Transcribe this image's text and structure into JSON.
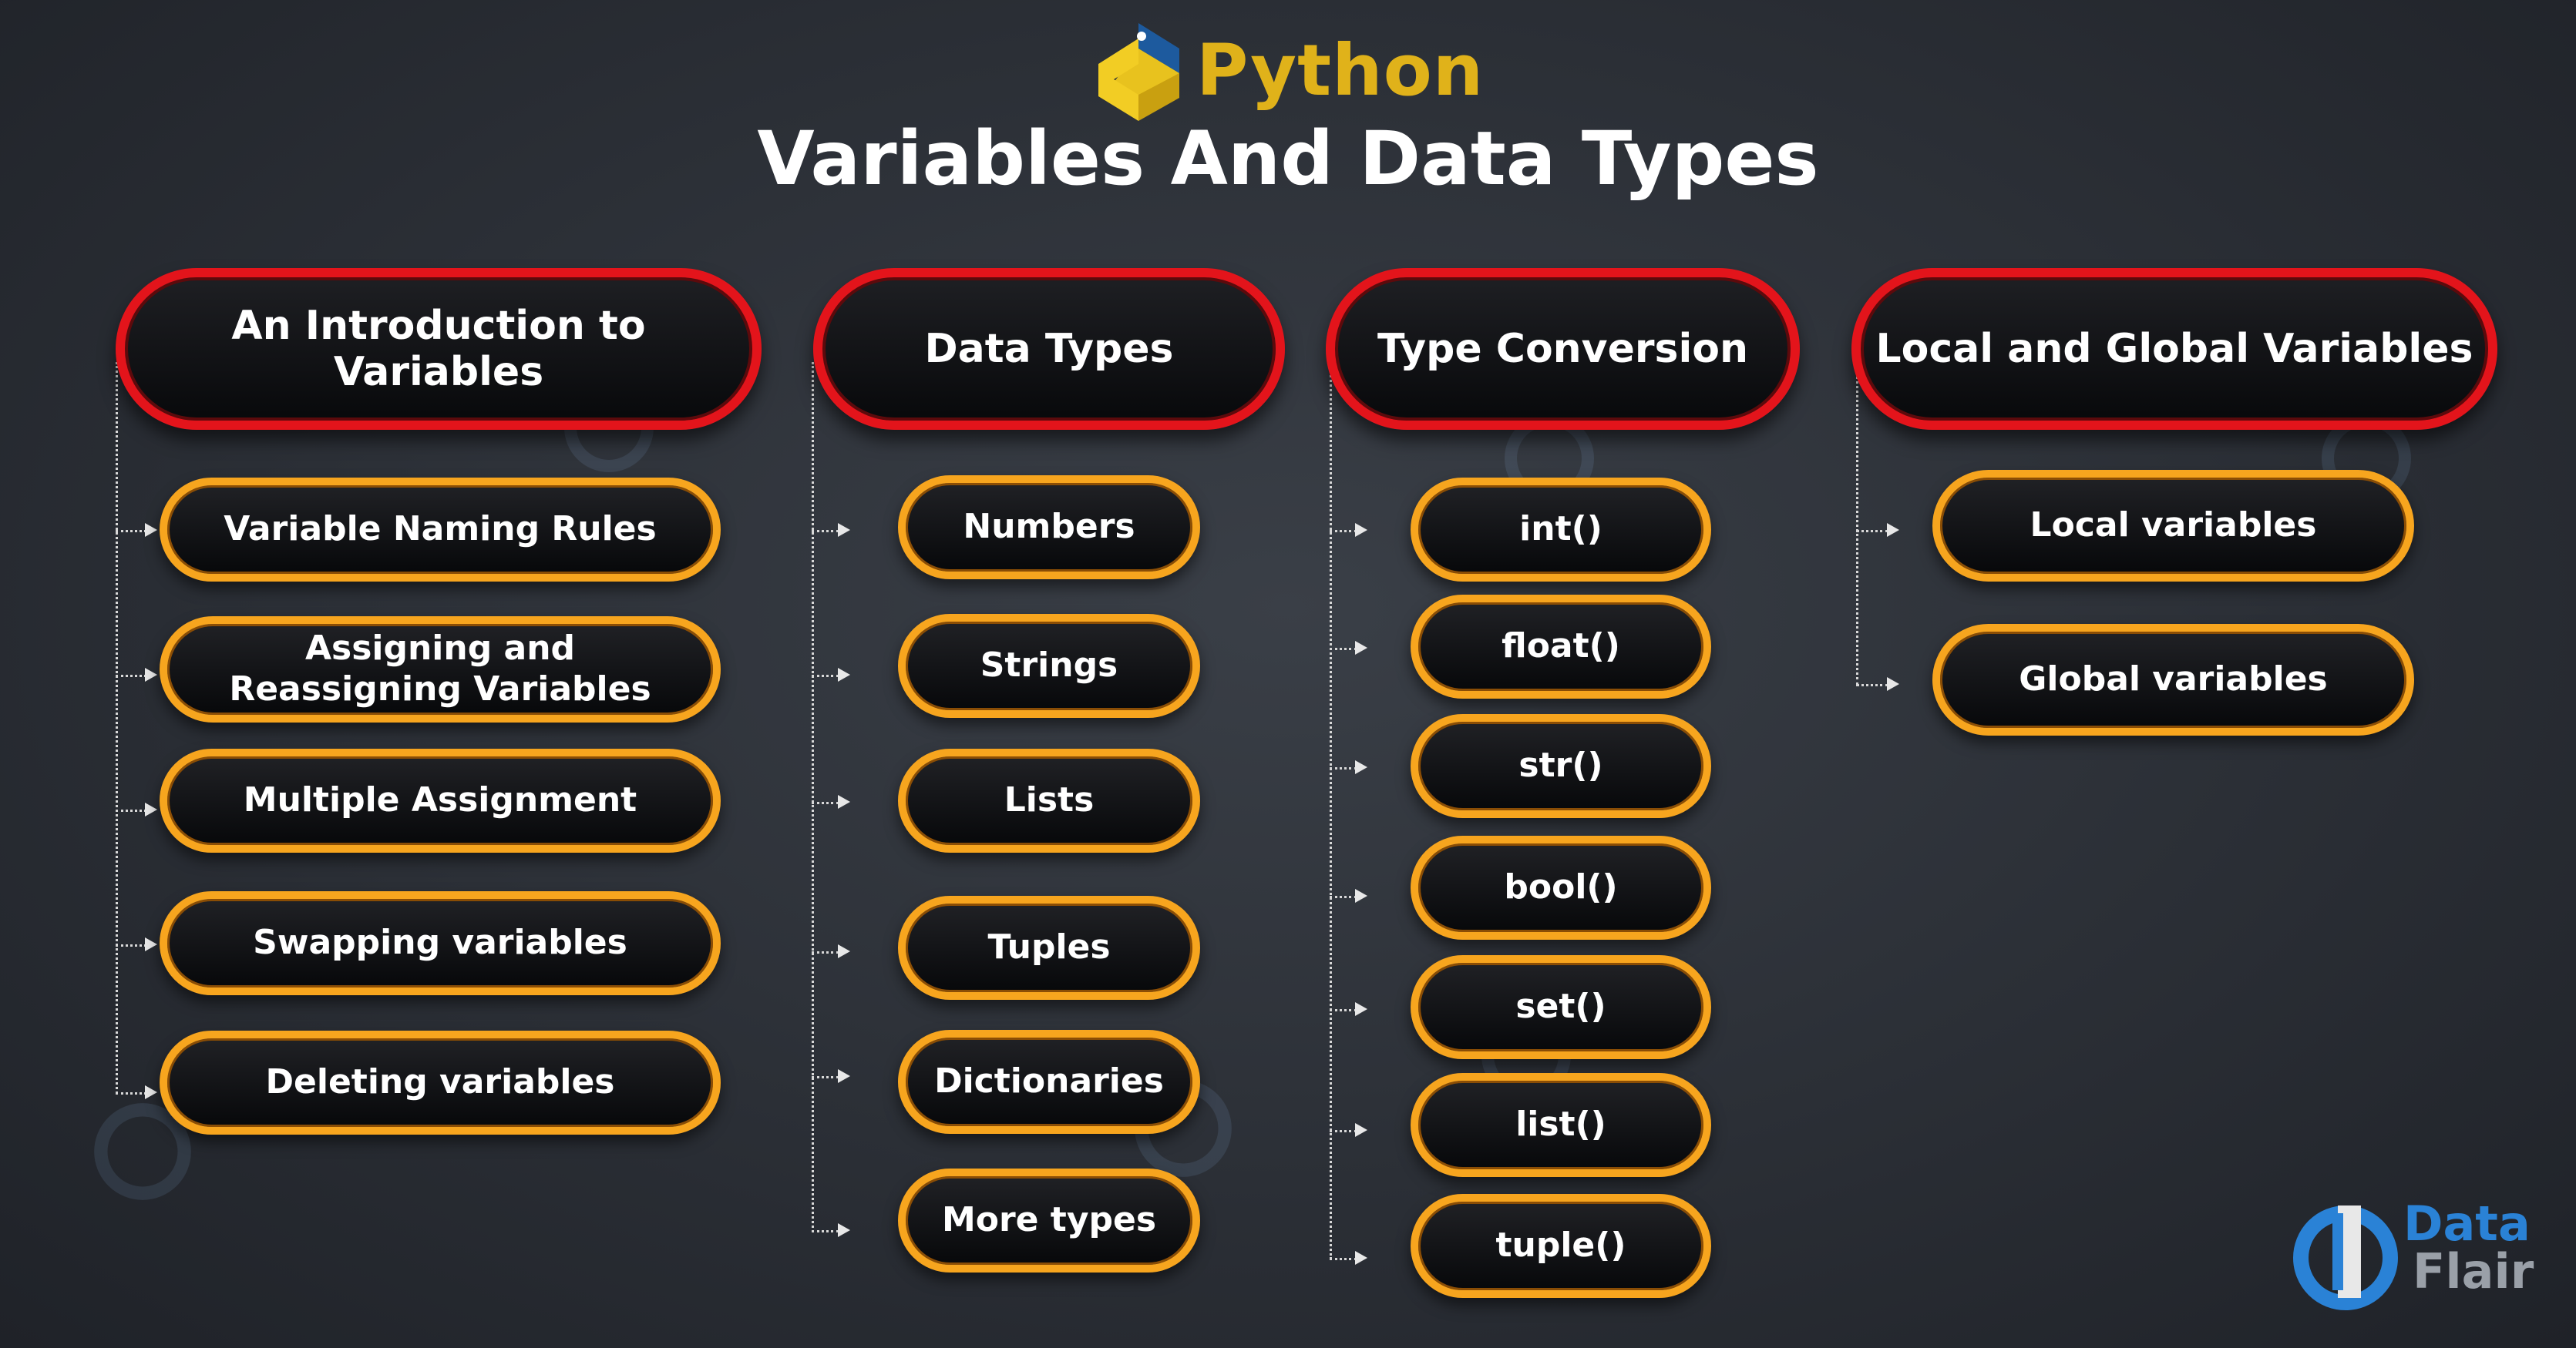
{
  "header": {
    "brand": "Python",
    "title": "Variables And Data Types"
  },
  "sections": [
    {
      "title": "An Introduction to Variables",
      "items": [
        "Variable Naming Rules",
        "Assigning and Reassigning Variables",
        "Multiple Assignment",
        "Swapping variables",
        "Deleting variables"
      ]
    },
    {
      "title": "Data Types",
      "items": [
        "Numbers",
        "Strings",
        "Lists",
        "Tuples",
        "Dictionaries",
        "More types"
      ]
    },
    {
      "title": "Type Conversion",
      "items": [
        "int()",
        "float()",
        "str()",
        "bool()",
        "set()",
        "list()",
        "tuple()"
      ]
    },
    {
      "title": "Local and Global Variables",
      "items": [
        "Local variables",
        "Global variables"
      ]
    }
  ],
  "brand_logo": {
    "word1": "Data",
    "word2": "Flair"
  },
  "colors": {
    "background": "#2b2f36",
    "heading_border": "#e3141b",
    "item_border": "#f7a51e",
    "python_yellow": "#e0b21a",
    "dataflair_blue": "#2a82d6"
  }
}
